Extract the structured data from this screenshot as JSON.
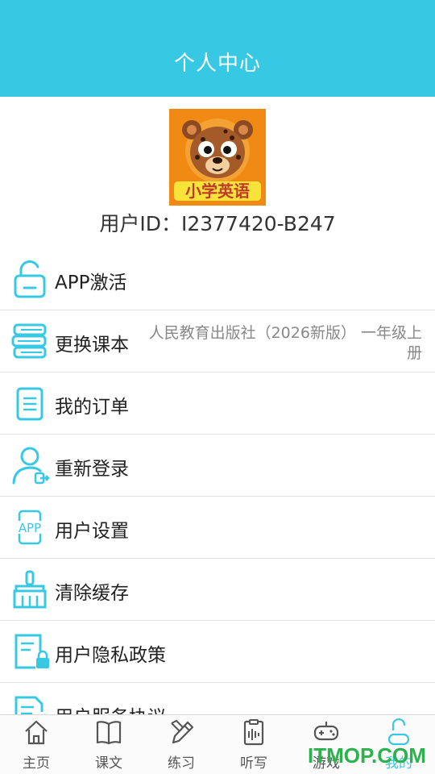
{
  "header": {
    "title": "个人中心"
  },
  "profile": {
    "avatar_text": "小学英语",
    "user_id": "用户ID：I2377420-B247"
  },
  "menu": {
    "items": [
      {
        "label": "APP激活",
        "icon": "unlock-icon"
      },
      {
        "label": "更换课本",
        "icon": "books-icon",
        "sub": "人民教育出版社（2026新版） 一年级上册"
      },
      {
        "label": "我的订单",
        "icon": "document-icon"
      },
      {
        "label": "重新登录",
        "icon": "user-logout-icon"
      },
      {
        "label": "用户设置",
        "icon": "app-settings-icon"
      },
      {
        "label": "清除缓存",
        "icon": "broom-icon"
      },
      {
        "label": "用户隐私政策",
        "icon": "privacy-lock-icon"
      },
      {
        "label": "用户服务协议",
        "icon": "agreement-icon"
      }
    ]
  },
  "tabbar": {
    "tabs": [
      {
        "label": "主页",
        "icon": "home-icon"
      },
      {
        "label": "课文",
        "icon": "book-icon"
      },
      {
        "label": "练习",
        "icon": "pencil-icon"
      },
      {
        "label": "听写",
        "icon": "dictation-icon"
      },
      {
        "label": "游戏",
        "icon": "gamepad-icon"
      },
      {
        "label": "我的",
        "icon": "profile-icon",
        "active": true
      }
    ]
  },
  "watermark": "ITMOP.COM",
  "colors": {
    "accent": "#37c8e4",
    "avatar_bg": "#f08a14",
    "watermark": "#2bb24c"
  }
}
